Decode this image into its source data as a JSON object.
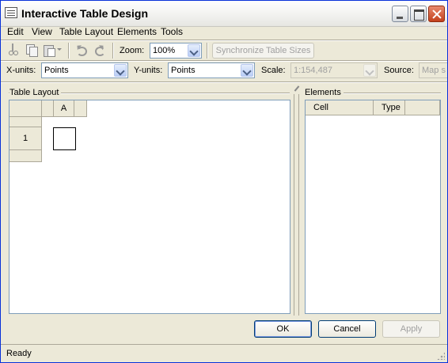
{
  "window": {
    "title": "Interactive Table Design"
  },
  "menu": [
    "Edit",
    "View",
    "Table Layout",
    "Elements",
    "Tools"
  ],
  "toolbar": {
    "zoom_label": "Zoom:",
    "zoom_value": "100%",
    "sync_label": "Synchronize Table Sizes",
    "icons": [
      "cut-icon",
      "copy-icon",
      "paste-icon",
      "undo-icon",
      "redo-icon"
    ]
  },
  "units": {
    "x_label": "X-units:",
    "x_value": "Points",
    "y_label": "Y-units:",
    "y_value": "Points",
    "scale_label": "Scale:",
    "scale_value": "1:154,487",
    "source_label": "Source:",
    "source_value": "Map s"
  },
  "table_layout": {
    "title": "Table Layout",
    "column_header": "A",
    "row_header": "1"
  },
  "elements": {
    "title": "Elements",
    "columns": [
      "Cell",
      "Type"
    ]
  },
  "buttons": {
    "ok": "OK",
    "cancel": "Cancel",
    "apply": "Apply"
  },
  "status": {
    "text": "Ready"
  }
}
